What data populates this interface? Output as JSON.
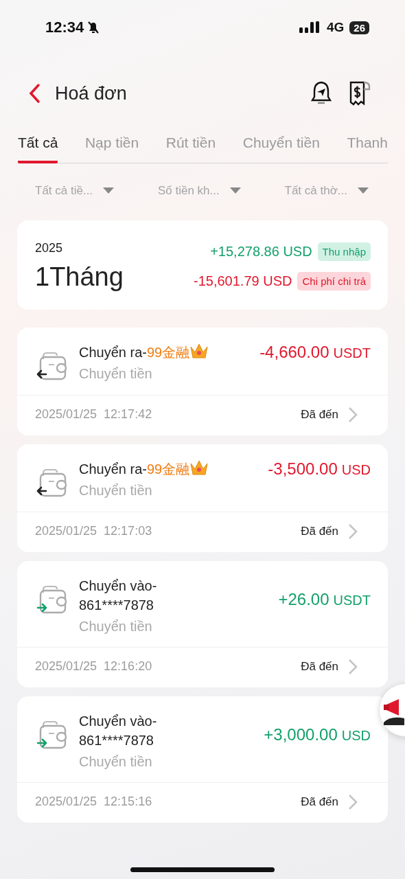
{
  "status_bar": {
    "time": "12:34",
    "silent": true,
    "network": "4G",
    "battery": "26"
  },
  "header": {
    "title": "Hoá đơn"
  },
  "tabs": [
    {
      "label": "Tất cả",
      "selected": true
    },
    {
      "label": "Nạp tiền",
      "selected": false
    },
    {
      "label": "Rút tiền",
      "selected": false
    },
    {
      "label": "Chuyển tiền",
      "selected": false
    },
    {
      "label": "Thanh",
      "selected": false
    }
  ],
  "filters": [
    "Tất cả tiề...",
    "Số tiền kh...",
    "Tất cả thờ..."
  ],
  "summary": {
    "year": "2025",
    "period": "1Tháng",
    "income": {
      "amount": "+15,278.86 USD",
      "label": "Thu nhập"
    },
    "expense": {
      "amount": "-15,601.79 USD",
      "label": "Chi phí chi trả"
    }
  },
  "transactions": [
    {
      "kind": "out",
      "title": "Chuyển ra-",
      "counterparty": "99金融",
      "vip": true,
      "type": "Chuyển tiền",
      "amount": "-4,660.00",
      "currency": "USDT",
      "date": "2025/01/25  12:17:42",
      "status": "Đã đến"
    },
    {
      "kind": "out",
      "title": "Chuyển ra-",
      "counterparty": "99金融",
      "vip": true,
      "type": "Chuyển tiền",
      "amount": "-3,500.00",
      "currency": "USD",
      "date": "2025/01/25  12:17:03",
      "status": "Đã đến"
    },
    {
      "kind": "in",
      "title": "Chuyển vào-861****7878",
      "vip": false,
      "type": "Chuyển tiền",
      "amount": "+26.00",
      "currency": "USDT",
      "date": "2025/01/25  12:16:20",
      "status": "Đã đến"
    },
    {
      "kind": "in",
      "title": "Chuyển vào-861****7878",
      "vip": false,
      "type": "Chuyển tiền",
      "amount": "+3,000.00",
      "currency": "USD",
      "date": "2025/01/25  12:15:16",
      "status": "Đã đến"
    }
  ]
}
